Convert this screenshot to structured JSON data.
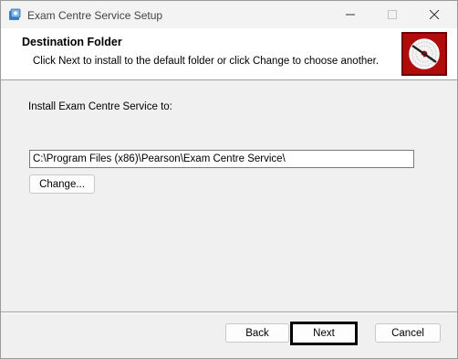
{
  "window": {
    "title": "Exam Centre Service Setup",
    "icon": "installer-icon",
    "controls": {
      "minimize": "minimize-icon",
      "maximize": "maximize-icon",
      "close": "close-icon"
    }
  },
  "header": {
    "title": "Destination Folder",
    "subtitle": "Click Next to install to the default folder or click Change to choose another.",
    "logo": "installer-disc-logo"
  },
  "main": {
    "install_label": "Install Exam Centre Service to:",
    "path_value": "C:\\Program Files (x86)\\Pearson\\Exam Centre Service\\",
    "change_button": "Change..."
  },
  "footer": {
    "back_button": "Back",
    "next_button": "Next",
    "cancel_button": "Cancel"
  },
  "colors": {
    "logo_red": "#b00c0c",
    "banner_background": "#ffffff",
    "dialog_background": "#f0f0f0"
  }
}
